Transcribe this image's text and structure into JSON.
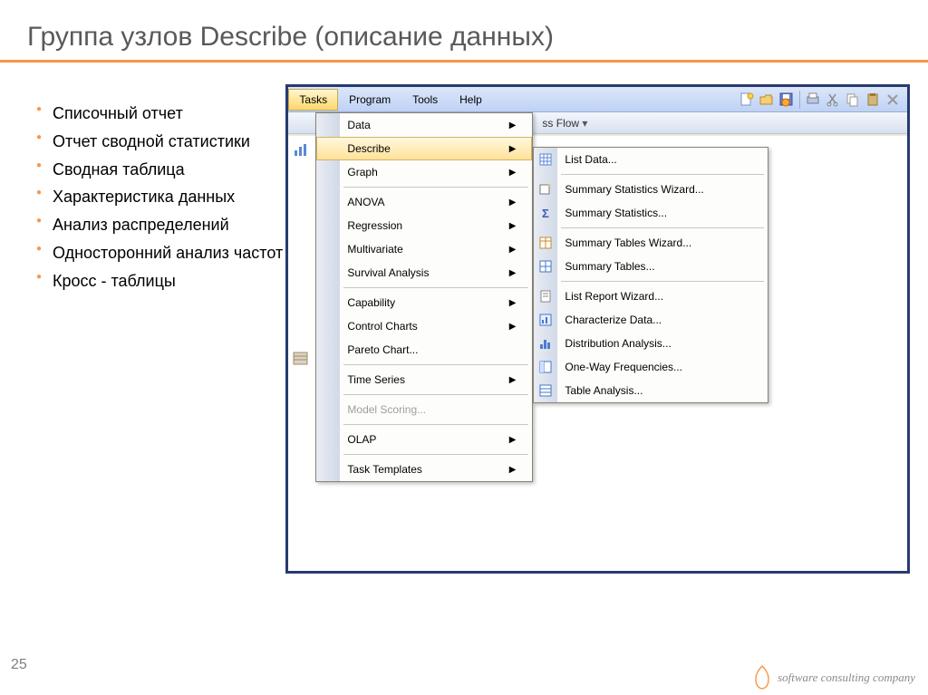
{
  "slide": {
    "title": "Группа узлов Describe (описание данных)",
    "number": "25",
    "footer": "software consulting company"
  },
  "bullets": [
    "Списочный отчет",
    "Отчет сводной статистики",
    "Сводная таблица",
    "Характеристика данных",
    "Анализ распределений",
    "Односторонний анализ частот",
    "Кросс - таблицы"
  ],
  "menubar": {
    "items": [
      "Tasks",
      "Program",
      "Tools",
      "Help"
    ],
    "active_index": 0
  },
  "process": {
    "label": "ss Flow",
    "arrow": "▾"
  },
  "tasks_menu": {
    "groups": [
      [
        {
          "label": "Data",
          "arrow": true
        },
        {
          "label": "Describe",
          "arrow": true,
          "selected": true
        },
        {
          "label": "Graph",
          "arrow": true
        }
      ],
      [
        {
          "label": "ANOVA",
          "arrow": true
        },
        {
          "label": "Regression",
          "arrow": true
        },
        {
          "label": "Multivariate",
          "arrow": true
        },
        {
          "label": "Survival Analysis",
          "arrow": true
        }
      ],
      [
        {
          "label": "Capability",
          "arrow": true
        },
        {
          "label": "Control Charts",
          "arrow": true
        },
        {
          "label": "Pareto Chart...",
          "arrow": false
        }
      ],
      [
        {
          "label": "Time Series",
          "arrow": true
        }
      ],
      [
        {
          "label": "Model Scoring...",
          "arrow": false,
          "disabled": true
        }
      ],
      [
        {
          "label": "OLAP",
          "arrow": true
        }
      ],
      [
        {
          "label": "Task Templates",
          "arrow": true
        }
      ]
    ]
  },
  "describe_submenu": {
    "groups": [
      [
        {
          "label": "List Data...",
          "icon": "table"
        }
      ],
      [
        {
          "label": "Summary Statistics Wizard...",
          "icon": "wizard"
        },
        {
          "label": "Summary Statistics...",
          "icon": "sigma"
        }
      ],
      [
        {
          "label": "Summary Tables Wizard...",
          "icon": "tablew"
        },
        {
          "label": "Summary Tables...",
          "icon": "table2"
        }
      ],
      [
        {
          "label": "List Report Wizard...",
          "icon": "report"
        },
        {
          "label": "Characterize Data...",
          "icon": "char"
        },
        {
          "label": "Distribution Analysis...",
          "icon": "hist"
        },
        {
          "label": "One-Way Frequencies...",
          "icon": "freq"
        },
        {
          "label": "Table Analysis...",
          "icon": "tablea"
        }
      ]
    ]
  }
}
